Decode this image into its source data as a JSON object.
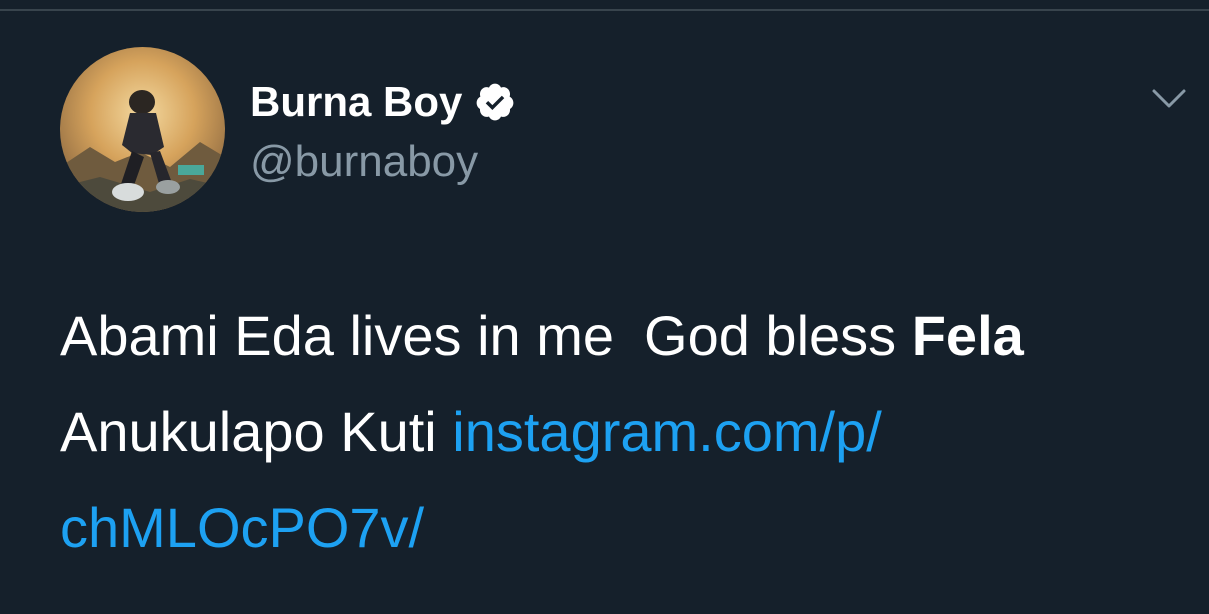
{
  "tweet": {
    "author": {
      "display_name": "Burna Boy",
      "handle": "@burnaboy",
      "verified": true,
      "avatar_icon": "profile-photo"
    },
    "menu_icon": "chevron-down-icon",
    "text_part1": "Abami Eda lives in me",
    "text_part2": "God bless",
    "text_bold": "Fela",
    "text_part3": "Anukulapo Kuti",
    "link_line1": "instagram.com/p/",
    "link_line2": "chMLOcPO7v/"
  },
  "colors": {
    "background": "#15202b",
    "primary_text": "#ffffff",
    "secondary_text": "#8899a6",
    "link": "#1da1f2",
    "divider": "#38444d"
  }
}
